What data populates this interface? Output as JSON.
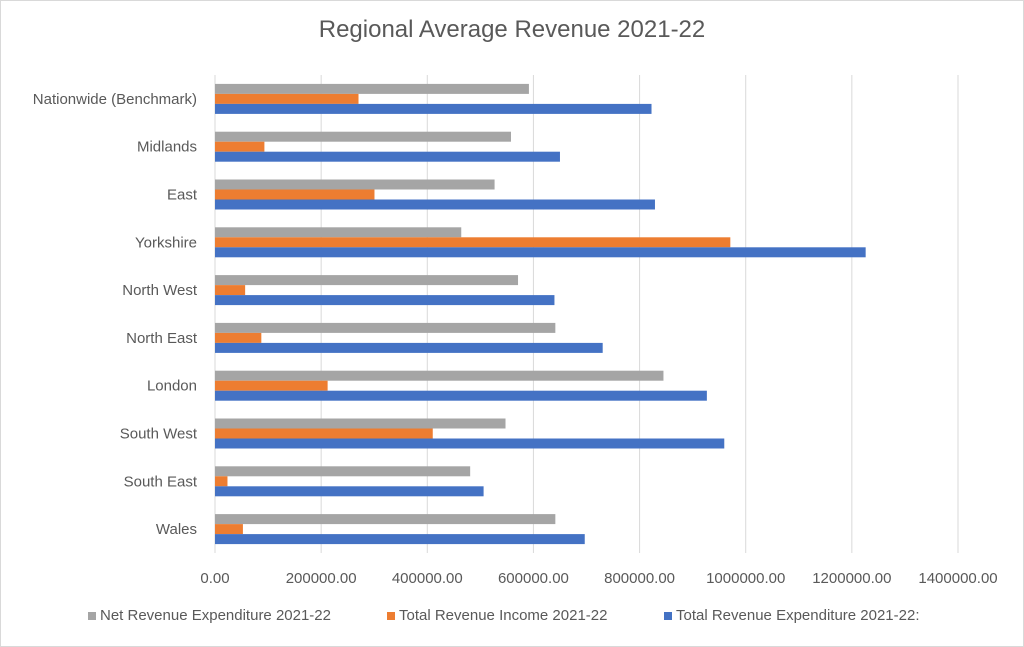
{
  "chart_data": {
    "type": "bar",
    "orientation": "horizontal",
    "title": "Regional Average Revenue 2021-22",
    "xlabel": "",
    "ylabel": "",
    "xlim": [
      0,
      1400000
    ],
    "x_ticks": [
      "0.00",
      "200000.00",
      "400000.00",
      "600000.00",
      "800000.00",
      "1000000.00",
      "1200000.00",
      "1400000.00"
    ],
    "grid": "vertical",
    "legend_position": "bottom",
    "categories": [
      "Nationwide (Benchmark)",
      "Midlands",
      "East",
      "Yorkshire",
      "North West",
      "North East",
      "London",
      "South West",
      "South East",
      "Wales"
    ],
    "series": [
      {
        "name": "Net Revenue Expenditure 2021-22",
        "color": "#a5a5a5",
        "values": [
          591500,
          557700,
          526800,
          464000,
          571000,
          641300,
          845000,
          547400,
          480800,
          641300
        ]
      },
      {
        "name": "Total Revenue Income 2021-22",
        "color": "#ed7d31",
        "values": [
          270400,
          93100,
          300500,
          971000,
          56800,
          87300,
          212200,
          410300,
          23500,
          52600
        ]
      },
      {
        "name": "Total Revenue Expenditure 2021-22:",
        "color": "#4472c4",
        "values": [
          822500,
          650000,
          829000,
          1226000,
          639600,
          730500,
          926800,
          959600,
          506100,
          696700
        ]
      }
    ]
  }
}
